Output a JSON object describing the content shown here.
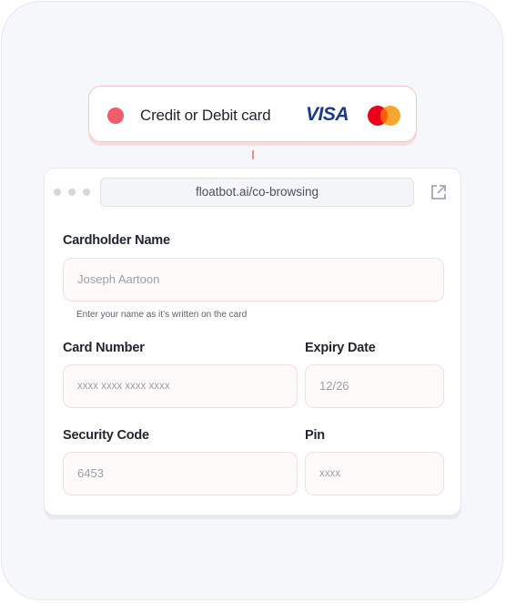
{
  "payment_option": {
    "label": "Credit or Debit card",
    "brands": [
      "VISA",
      "Mastercard"
    ],
    "visa_text": "VISA",
    "radio_color": "#ef5c6a"
  },
  "browser": {
    "url": "floatbot.ai/co-browsing",
    "window_controls": [
      "dot",
      "dot",
      "dot"
    ],
    "external_icon": "external-link-icon"
  },
  "form": {
    "cardholder": {
      "label": "Cardholder Name",
      "placeholder": "Joseph Aartoon",
      "helper": "Enter your name as it’s written on the card"
    },
    "card_number": {
      "label": "Card Number",
      "placeholder": "xxxx xxxx xxxx xxxx"
    },
    "expiry": {
      "label": "Expiry Date",
      "placeholder": "12/26"
    },
    "security_code": {
      "label": "Security Code",
      "placeholder": "6453"
    },
    "pin": {
      "label": "Pin",
      "placeholder": "xxxx"
    }
  },
  "colors": {
    "accent": "#ef5c6a",
    "visa_blue": "#1a3a8f",
    "mc_red": "#eb001b",
    "mc_orange": "#f79e1b"
  }
}
